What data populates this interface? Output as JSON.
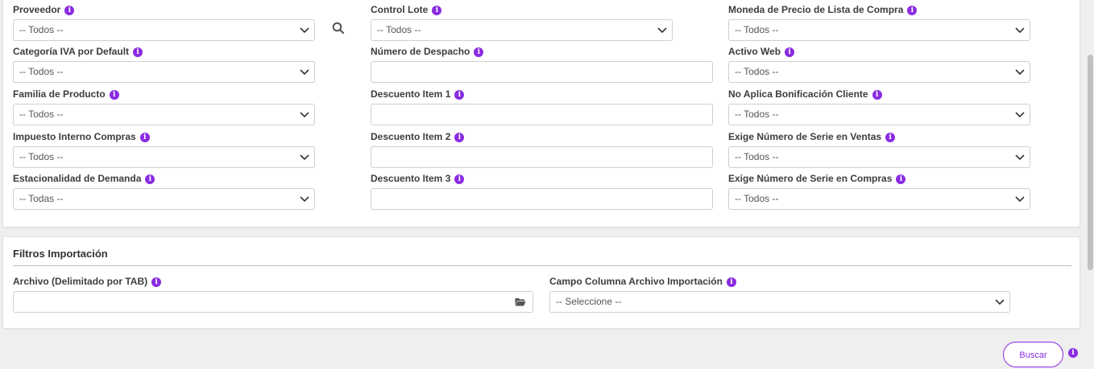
{
  "filters": {
    "col1": [
      {
        "label": "Proveedor",
        "value": "-- Todos --"
      },
      {
        "label": "Categoría IVA por Default",
        "value": "-- Todos --"
      },
      {
        "label": "Familia de Producto",
        "value": "-- Todos --"
      },
      {
        "label": "Impuesto Interno Compras",
        "value": "-- Todos --"
      },
      {
        "label": "Estacionalidad de Demanda",
        "value": "-- Todas --"
      }
    ],
    "col2": [
      {
        "label": "Control Lote",
        "value": "-- Todos --"
      },
      {
        "label": "Número de Despacho",
        "value": ""
      },
      {
        "label": "Descuento Item 1",
        "value": ""
      },
      {
        "label": "Descuento Item 2",
        "value": ""
      },
      {
        "label": "Descuento Item 3",
        "value": ""
      }
    ],
    "col3": [
      {
        "label": "Moneda de Precio de Lista de Compra",
        "value": "-- Todos --"
      },
      {
        "label": "Activo Web",
        "value": "-- Todos --"
      },
      {
        "label": "No Aplica Bonificación Cliente",
        "value": "-- Todos --"
      },
      {
        "label": "Exige Número de Serie en Ventas",
        "value": "-- Todos --"
      },
      {
        "label": "Exige Número de Serie en Compras",
        "value": "-- Todos --"
      }
    ]
  },
  "import_section": {
    "title": "Filtros Importación",
    "file_label": "Archivo (Delimitado por TAB)",
    "file_value": "",
    "column_label": "Campo Columna Archivo Importación",
    "column_value": "-- Seleccione --"
  },
  "actions": {
    "search_label": "Buscar"
  },
  "icons": {
    "info": "info-icon",
    "chevron": "chevron-down-icon",
    "search": "search-icon",
    "folder": "folder-open-icon"
  },
  "colors": {
    "accent": "#8a2be2"
  }
}
